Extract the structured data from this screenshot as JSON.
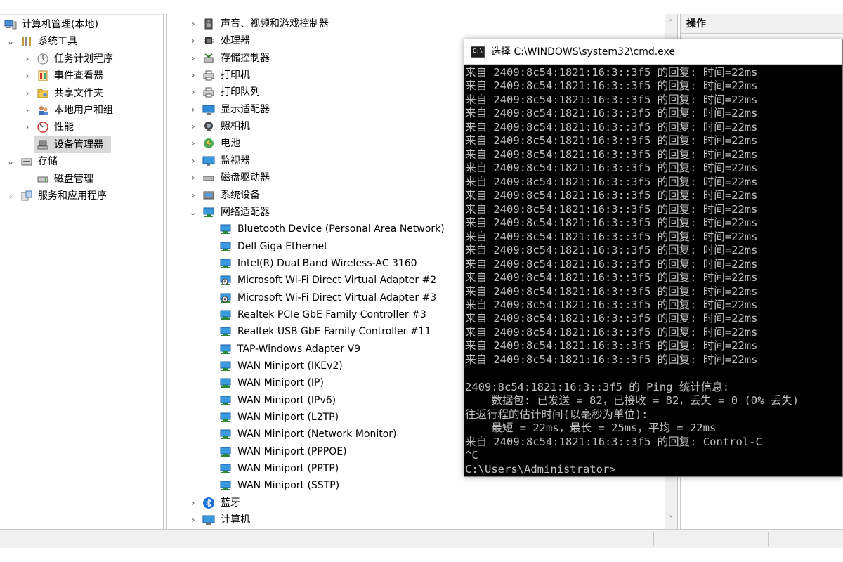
{
  "left_tree": {
    "items": [
      {
        "label": "计算机管理(本地)",
        "chev": "",
        "level": 0
      },
      {
        "label": "系统工具",
        "chev": "⌄",
        "level": 1
      },
      {
        "label": "任务计划程序",
        "chev": "›",
        "level": 2
      },
      {
        "label": "事件查看器",
        "chev": "›",
        "level": 2
      },
      {
        "label": "共享文件夹",
        "chev": "›",
        "level": 2
      },
      {
        "label": "本地用户和组",
        "chev": "›",
        "level": 2
      },
      {
        "label": "性能",
        "chev": "›",
        "level": 2
      },
      {
        "label": "设备管理器",
        "chev": "",
        "level": 2,
        "selected": true
      },
      {
        "label": "存储",
        "chev": "⌄",
        "level": 1
      },
      {
        "label": "磁盘管理",
        "chev": "",
        "level": 2
      },
      {
        "label": "服务和应用程序",
        "chev": "›",
        "level": 1
      }
    ]
  },
  "device_list": {
    "categories": [
      {
        "label": "声音、视频和游戏控制器",
        "chev": "›",
        "icon": "speaker-icon"
      },
      {
        "label": "处理器",
        "chev": "›",
        "icon": "processor-icon"
      },
      {
        "label": "存储控制器",
        "chev": "›",
        "icon": "storage-controller-icon"
      },
      {
        "label": "打印机",
        "chev": "›",
        "icon": "printer-icon"
      },
      {
        "label": "打印队列",
        "chev": "›",
        "icon": "print-queue-icon"
      },
      {
        "label": "显示适配器",
        "chev": "›",
        "icon": "display-adapter-icon"
      },
      {
        "label": "照相机",
        "chev": "›",
        "icon": "camera-icon"
      },
      {
        "label": "电池",
        "chev": "›",
        "icon": "battery-icon"
      },
      {
        "label": "监视器",
        "chev": "›",
        "icon": "monitor-icon"
      },
      {
        "label": "磁盘驱动器",
        "chev": "›",
        "icon": "disk-drive-icon"
      },
      {
        "label": "系统设备",
        "chev": "›",
        "icon": "system-device-icon"
      },
      {
        "label": "网络适配器",
        "chev": "⌄",
        "icon": "network-adapter-icon"
      }
    ],
    "network_adapters": [
      "Bluetooth Device (Personal Area Network)",
      "Dell Giga Ethernet",
      "Intel(R) Dual Band Wireless-AC 3160",
      "Microsoft Wi-Fi Direct Virtual Adapter #2",
      "Microsoft Wi-Fi Direct Virtual Adapter #3",
      "Realtek PCIe GbE Family Controller #3",
      "Realtek USB GbE Family Controller #11",
      "TAP-Windows Adapter V9",
      "WAN Miniport (IKEv2)",
      "WAN Miniport (IP)",
      "WAN Miniport (IPv6)",
      "WAN Miniport (L2TP)",
      "WAN Miniport (Network Monitor)",
      "WAN Miniport (PPPOE)",
      "WAN Miniport (PPTP)",
      "WAN Miniport (SSTP)"
    ],
    "trailing_categories": [
      {
        "label": "蓝牙",
        "chev": "›",
        "icon": "bluetooth-icon"
      },
      {
        "label": "计算机",
        "chev": "›",
        "icon": "computer-icon"
      }
    ],
    "scroll_up": "˄",
    "scroll_down": "˅"
  },
  "actions_pane": {
    "header": "操作"
  },
  "cmd": {
    "title": "选择 C:\\WINDOWS\\system32\\cmd.exe",
    "icon_text": "C:\\",
    "lines": [
      "来自 2409:8c54:1821:16:3::3f5 的回复: 时间=22ms",
      "来自 2409:8c54:1821:16:3::3f5 的回复: 时间=22ms",
      "来自 2409:8c54:1821:16:3::3f5 的回复: 时间=22ms",
      "来自 2409:8c54:1821:16:3::3f5 的回复: 时间=22ms",
      "来自 2409:8c54:1821:16:3::3f5 的回复: 时间=22ms",
      "来自 2409:8c54:1821:16:3::3f5 的回复: 时间=22ms",
      "来自 2409:8c54:1821:16:3::3f5 的回复: 时间=22ms",
      "来自 2409:8c54:1821:16:3::3f5 的回复: 时间=22ms",
      "来自 2409:8c54:1821:16:3::3f5 的回复: 时间=22ms",
      "来自 2409:8c54:1821:16:3::3f5 的回复: 时间=22ms",
      "来自 2409:8c54:1821:16:3::3f5 的回复: 时间=22ms",
      "来自 2409:8c54:1821:16:3::3f5 的回复: 时间=22ms",
      "来自 2409:8c54:1821:16:3::3f5 的回复: 时间=22ms",
      "来自 2409:8c54:1821:16:3::3f5 的回复: 时间=22ms",
      "来自 2409:8c54:1821:16:3::3f5 的回复: 时间=22ms",
      "来自 2409:8c54:1821:16:3::3f5 的回复: 时间=22ms",
      "来自 2409:8c54:1821:16:3::3f5 的回复: 时间=22ms",
      "来自 2409:8c54:1821:16:3::3f5 的回复: 时间=22ms",
      "来自 2409:8c54:1821:16:3::3f5 的回复: 时间=22ms",
      "来自 2409:8c54:1821:16:3::3f5 的回复: 时间=22ms",
      "来自 2409:8c54:1821:16:3::3f5 的回复: 时间=22ms",
      "来自 2409:8c54:1821:16:3::3f5 的回复: 时间=22ms",
      "",
      "2409:8c54:1821:16:3::3f5 的 Ping 统计信息:",
      "    数据包: 已发送 = 82，已接收 = 82，丢失 = 0 (0% 丢失)",
      "往返行程的估计时间(以毫秒为单位):",
      "    最短 = 22ms，最长 = 25ms，平均 = 22ms",
      "来自 2409:8c54:1821:16:3::3f5 的回复: Control-C",
      "^C",
      "C:\\Users\\Administrator>"
    ]
  }
}
